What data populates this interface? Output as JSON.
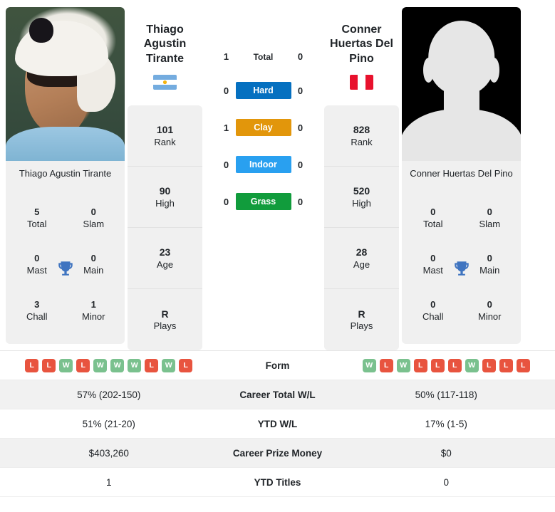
{
  "players": {
    "left": {
      "name": "Thiago Agustin Tirante",
      "caption": "Thiago Agustin Tirante",
      "country": "Argentina",
      "flag_icon": "argentina-flag-icon",
      "photo_icon": "player-photo",
      "titles": {
        "total_value": "5",
        "total_label": "Total",
        "slam_value": "0",
        "slam_label": "Slam",
        "mast_value": "0",
        "mast_label": "Mast",
        "main_value": "0",
        "main_label": "Main",
        "chall_value": "3",
        "chall_label": "Chall",
        "minor_value": "1",
        "minor_label": "Minor"
      },
      "profile": [
        {
          "value": "101",
          "label": "Rank"
        },
        {
          "value": "90",
          "label": "High"
        },
        {
          "value": "23",
          "label": "Age"
        },
        {
          "value": "R",
          "label": "Plays"
        }
      ],
      "form": [
        "L",
        "L",
        "W",
        "L",
        "W",
        "W",
        "W",
        "L",
        "W",
        "L"
      ],
      "career_total_wl": "57% (202-150)",
      "ytd_wl": "51% (21-20)",
      "career_prize_money": "$403,260",
      "ytd_titles": "1"
    },
    "right": {
      "name": "Conner Huertas Del Pino",
      "caption": "Conner Huertas Del Pino",
      "country": "Peru",
      "flag_icon": "peru-flag-icon",
      "photo_icon": "player-photo-placeholder",
      "titles": {
        "total_value": "0",
        "total_label": "Total",
        "slam_value": "0",
        "slam_label": "Slam",
        "mast_value": "0",
        "mast_label": "Mast",
        "main_value": "0",
        "main_label": "Main",
        "chall_value": "0",
        "chall_label": "Chall",
        "minor_value": "0",
        "minor_label": "Minor"
      },
      "profile": [
        {
          "value": "828",
          "label": "Rank"
        },
        {
          "value": "520",
          "label": "High"
        },
        {
          "value": "28",
          "label": "Age"
        },
        {
          "value": "R",
          "label": "Plays"
        }
      ],
      "form": [
        "W",
        "L",
        "W",
        "L",
        "L",
        "L",
        "W",
        "L",
        "L",
        "L"
      ],
      "career_total_wl": "50% (117-118)",
      "ytd_wl": "17% (1-5)",
      "career_prize_money": "$0",
      "ytd_titles": "0"
    }
  },
  "head_to_head": [
    {
      "label": "Total",
      "left": "1",
      "right": "0",
      "style": "plain",
      "color": ""
    },
    {
      "label": "Hard",
      "left": "0",
      "right": "0",
      "style": "pill",
      "color": "#0570c0"
    },
    {
      "label": "Clay",
      "left": "1",
      "right": "0",
      "style": "pill",
      "color": "#e2960b"
    },
    {
      "label": "Indoor",
      "left": "0",
      "right": "0",
      "style": "pill",
      "color": "#29a0f0"
    },
    {
      "label": "Grass",
      "left": "0",
      "right": "0",
      "style": "pill",
      "color": "#119c3c"
    }
  ],
  "stats_rows": [
    {
      "label": "Form",
      "type": "form",
      "shaded": false
    },
    {
      "label": "Career Total W/L",
      "type": "text",
      "shaded": true,
      "left": "57% (202-150)",
      "right": "50% (117-118)"
    },
    {
      "label": "YTD W/L",
      "type": "text",
      "shaded": false,
      "left": "51% (21-20)",
      "right": "17% (1-5)"
    },
    {
      "label": "Career Prize Money",
      "type": "text",
      "shaded": true,
      "left": "$403,260",
      "right": "$0"
    },
    {
      "label": "YTD Titles",
      "type": "text",
      "shaded": false,
      "left": "1",
      "right": "0"
    }
  ],
  "colors": {
    "win_badge": "#7ac18e",
    "loss_badge": "#e8543f",
    "trophy": "#3f74c0",
    "card_bg": "#f0f0f0",
    "row_shade": "#f1f1f1"
  },
  "icons": {
    "trophy": "trophy-icon"
  }
}
